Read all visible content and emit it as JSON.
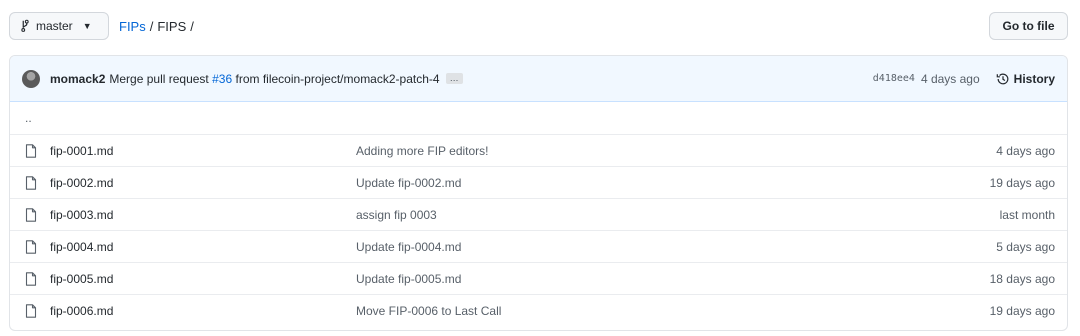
{
  "topbar": {
    "branch": "master",
    "breadcrumb": {
      "repo": "FIPs",
      "separator": "/",
      "dir": "FIPS",
      "trailing": "/"
    },
    "goto_label": "Go to file"
  },
  "commit": {
    "author": "momack2",
    "message_prefix": "Merge pull request",
    "pr_link": "#36",
    "message_suffix": "from filecoin-project/momack2-patch-4",
    "ellipsis": "…",
    "sha": "d418ee4",
    "age": "4 days ago",
    "history_label": "History"
  },
  "parent_dir": "..",
  "files": [
    {
      "name": "fip-0001.md",
      "message": "Adding more FIP editors!",
      "age": "4 days ago"
    },
    {
      "name": "fip-0002.md",
      "message": "Update fip-0002.md",
      "age": "19 days ago"
    },
    {
      "name": "fip-0003.md",
      "message": "assign fip 0003",
      "age": "last month"
    },
    {
      "name": "fip-0004.md",
      "message": "Update fip-0004.md",
      "age": "5 days ago"
    },
    {
      "name": "fip-0005.md",
      "message": "Update fip-0005.md",
      "age": "18 days ago"
    },
    {
      "name": "fip-0006.md",
      "message": "Move FIP-0006 to Last Call",
      "age": "19 days ago"
    }
  ],
  "icons": {
    "branch": "git-branch-icon",
    "file": "file-icon",
    "history": "history-icon"
  }
}
